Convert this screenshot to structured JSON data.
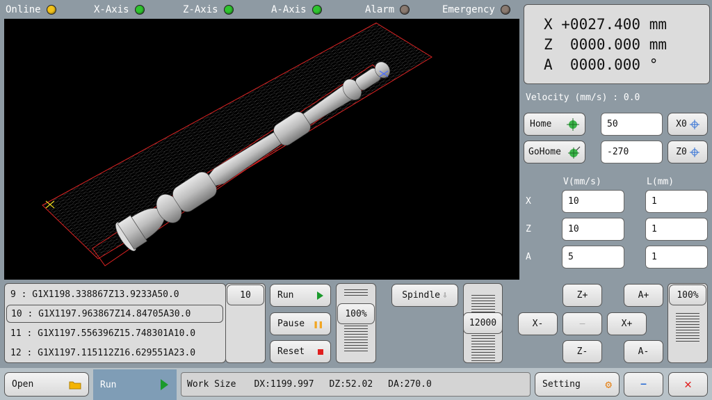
{
  "status": [
    {
      "label": "Online",
      "color": "#f2c21b"
    },
    {
      "label": "X-Axis",
      "color": "#2fc42f"
    },
    {
      "label": "Z-Axis",
      "color": "#2fc42f"
    },
    {
      "label": "A-Axis",
      "color": "#2fc42f"
    },
    {
      "label": "Alarm",
      "color": "#8a7a70"
    },
    {
      "label": "Emergency",
      "color": "#8a7a70"
    }
  ],
  "readout": {
    "x": "X +0027.400 mm",
    "z": "Z  0000.000 mm",
    "a": "A  0000.000 °"
  },
  "velocity": "Velocity (mm/s) : 0.0",
  "home": {
    "home_label": "Home",
    "gohome_label": "GoHome",
    "home_value": "50",
    "gohome_value": "-270",
    "x0_label": "X0",
    "z0_label": "Z0"
  },
  "params": {
    "v_header": "V(mm/s)",
    "l_header": "L(mm)",
    "rows": [
      {
        "axis": "X",
        "v": "10",
        "l": "1"
      },
      {
        "axis": "Z",
        "v": "10",
        "l": "1"
      },
      {
        "axis": "A",
        "v": "5",
        "l": "1"
      }
    ]
  },
  "gcode": [
    "9 : G1X1198.338867Z13.9233A50.0",
    "10 : G1X1197.963867Z14.84705A30.0",
    "11 : G1X1197.556396Z15.748301A10.0",
    "12 : G1X1197.115112Z16.629551A23.0"
  ],
  "line_step": "10",
  "controls": {
    "run": "Run",
    "pause": "Pause",
    "reset": "Reset",
    "feed_pct": "100%",
    "spindle": "Spindle",
    "spindle_speed": "12000",
    "jog_pct": "100%"
  },
  "jog": {
    "zplus": "Z+",
    "zminus": "Z-",
    "xminus": "X-",
    "xplus": "X+",
    "aplus": "A+",
    "aminus": "A-",
    "center": "—"
  },
  "bottom": {
    "open": "Open",
    "run_tab": "Run",
    "work_size_label": "Work Size",
    "dx": "DX:1199.997",
    "dz": "DZ:52.02",
    "da": "DA:270.0",
    "setting": "Setting",
    "minimize": "—",
    "close": "✕"
  }
}
